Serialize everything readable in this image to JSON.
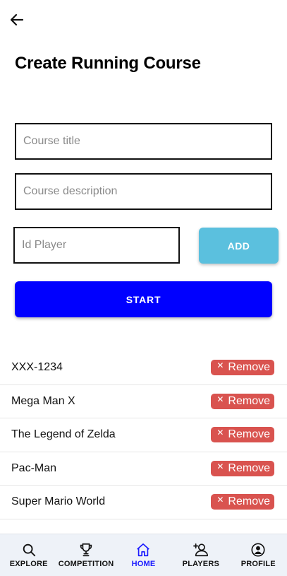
{
  "page": {
    "title": "Create Running Course"
  },
  "form": {
    "title_placeholder": "Course title",
    "description_placeholder": "Course description",
    "player_placeholder": "Id Player",
    "add_label": "ADD",
    "start_label": "START"
  },
  "players": [
    {
      "name": "XXX-1234",
      "remove_label": "Remove"
    },
    {
      "name": "Mega Man X",
      "remove_label": "Remove"
    },
    {
      "name": "The Legend of Zelda",
      "remove_label": "Remove"
    },
    {
      "name": "Pac-Man",
      "remove_label": "Remove"
    },
    {
      "name": "Super Mario World",
      "remove_label": "Remove"
    }
  ],
  "nav": {
    "items": [
      {
        "label": "EXPLORE",
        "icon": "search-icon"
      },
      {
        "label": "COMPETITION",
        "icon": "trophy-icon"
      },
      {
        "label": "HOME",
        "icon": "home-icon",
        "active": true
      },
      {
        "label": "PLAYERS",
        "icon": "add-user-icon"
      },
      {
        "label": "PROFILE",
        "icon": "profile-icon"
      }
    ]
  },
  "colors": {
    "add_button": "#5bc0de",
    "start_button": "#0000ff",
    "remove_button": "#d9534f",
    "active_nav": "#1a1aff",
    "nav_background": "#eef2f8"
  }
}
